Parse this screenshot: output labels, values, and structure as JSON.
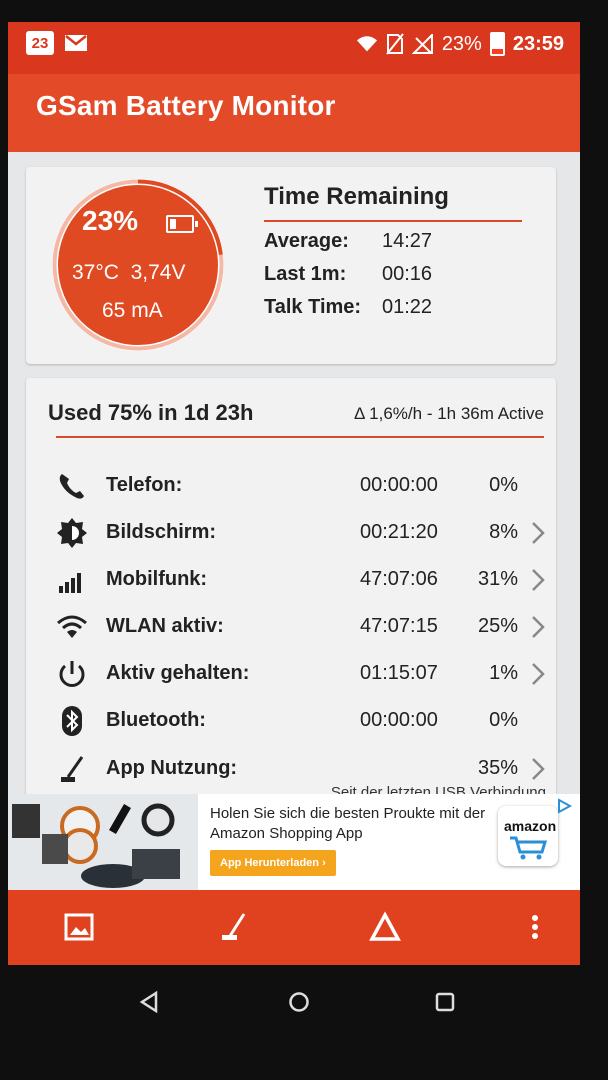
{
  "status_bar": {
    "notif_day": "23",
    "battery_pct": "23%",
    "time": "23:59"
  },
  "app": {
    "title": "GSam Battery Monitor"
  },
  "gauge": {
    "percent": "23%",
    "level": 0.23,
    "temp_volt": "37°C  3,74V",
    "current": "65 mA"
  },
  "time_remaining": {
    "title": "Time Remaining",
    "rows": [
      {
        "label": "Average:",
        "value": "14:27"
      },
      {
        "label": "Last 1m:",
        "value": "00:16"
      },
      {
        "label": "Talk Time:",
        "value": "01:22"
      }
    ]
  },
  "usage": {
    "title": "Used 75% in 1d 23h",
    "rate": "Δ 1,6%/h - 1h 36m Active",
    "rows": [
      {
        "icon": "phone-icon",
        "label": "Telefon:",
        "time": "00:00:00",
        "pct": "0%",
        "chevron": false
      },
      {
        "icon": "brightness-icon",
        "label": "Bildschirm:",
        "time": "00:21:20",
        "pct": "8%",
        "chevron": true
      },
      {
        "icon": "cell-signal-icon",
        "label": "Mobilfunk:",
        "time": "47:07:06",
        "pct": "31%",
        "chevron": true
      },
      {
        "icon": "wifi-icon",
        "label": "WLAN aktiv:",
        "time": "47:07:15",
        "pct": "25%",
        "chevron": true
      },
      {
        "icon": "power-icon",
        "label": "Aktiv gehalten:",
        "time": "01:15:07",
        "pct": "1%",
        "chevron": true
      },
      {
        "icon": "bluetooth-icon",
        "label": "Bluetooth:",
        "time": "00:00:00",
        "pct": "0%",
        "chevron": false
      },
      {
        "icon": "app-usage-icon",
        "label": "App Nutzung:",
        "time": "",
        "pct": "35%",
        "chevron": true
      }
    ],
    "footer": "Seit der letzten USB Verbindung"
  },
  "ad": {
    "text": "Holen Sie sich die besten Proukte mit der Amazon Shopping App",
    "button": "App Herunterladen ›",
    "brand": "amazon"
  },
  "colors": {
    "status_bar": "#d9381e",
    "app_bar": "#e34b28",
    "gauge_fill": "#e04a22",
    "accent_line": "#d64a2a"
  }
}
